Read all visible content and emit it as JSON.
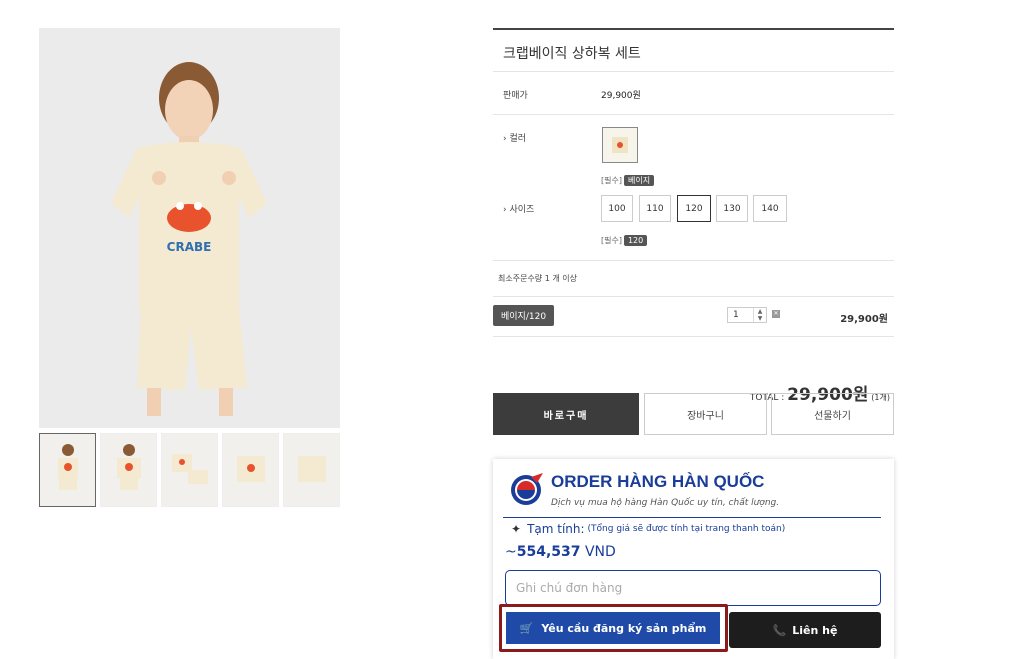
{
  "product": {
    "name": "크랩베이직 상하복 세트",
    "price_label": "판매가",
    "price": "29,900원",
    "color_label": "› 컬러",
    "color_required": "[필수]",
    "color_selected": "베이지",
    "size_label": "› 사이즈",
    "sizes": [
      "100",
      "110",
      "120",
      "130",
      "140"
    ],
    "size_required": "[필수]",
    "size_selected": "120",
    "min_order": "최소주문수량 1 개 이상",
    "selected_option": "베이지/120",
    "quantity": "1",
    "option_price": "29,900원",
    "total_label": "TOTAL :",
    "total_value": "29,900원",
    "total_count": "(1개)"
  },
  "buttons": {
    "buy": "바로구매",
    "cart": "장바구니",
    "gift": "선물하기"
  },
  "order_widget": {
    "brand": "ORDER HÀNG HÀN QUỐC",
    "tagline": "Dịch vụ mua hộ hàng Hàn Quốc uy tín, chất lượng.",
    "estimate_label": "Tạm tính:",
    "estimate_note": "(Tổng giá sẽ được tính tại trang thanh toán)",
    "price_prefix": "~",
    "price_value": "554,537",
    "price_currency": "VND",
    "note_placeholder": "Ghi chú đơn hàng",
    "register_button": "Yêu cầu đăng ký sản phẩm",
    "contact_button": "Liên hệ"
  },
  "gallery": {
    "shirt_text": "CRABE",
    "thumbnail_count": 5
  },
  "colors": {
    "brand_blue": "#1a3d9a",
    "button_blue": "#1f4aa8",
    "highlight_red": "#8b1a1a",
    "dark_button": "#3c3c3c"
  }
}
